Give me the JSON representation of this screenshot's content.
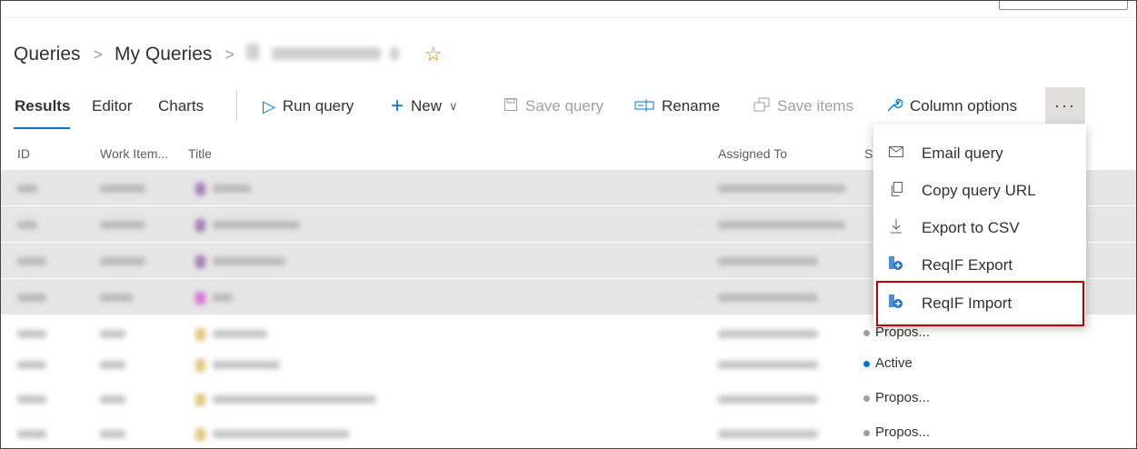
{
  "breadcrumb": {
    "root": "Queries",
    "folder": "My Queries"
  },
  "tabs": [
    "Results",
    "Editor",
    "Charts"
  ],
  "toolbar": {
    "run_query": "Run query",
    "new": "New",
    "save_query": "Save query",
    "rename": "Rename",
    "save_items": "Save items",
    "column_options": "Column options",
    "more": "···"
  },
  "columns": {
    "id": "ID",
    "type": "Work Item...",
    "title": "Title",
    "assigned": "Assigned To",
    "state": "St"
  },
  "rows": [
    {
      "state": ""
    },
    {
      "state": ""
    },
    {
      "state": ""
    },
    {
      "state": ""
    },
    {
      "state": "Propos..."
    },
    {
      "state": "Active"
    },
    {
      "state": "Propos..."
    },
    {
      "state": "Propos..."
    }
  ],
  "menu": {
    "items": [
      {
        "label": "Email query",
        "icon": "mail-icon"
      },
      {
        "label": "Copy query URL",
        "icon": "copy-icon"
      },
      {
        "label": "Export to CSV",
        "icon": "download-icon"
      },
      {
        "label": "ReqIF Export",
        "icon": "reqif-icon"
      },
      {
        "label": "ReqIF Import",
        "icon": "reqif-icon"
      }
    ]
  },
  "colors": {
    "accent": "#0078d4",
    "highlight_border": "#c00000",
    "active_state": "#0078d4"
  }
}
